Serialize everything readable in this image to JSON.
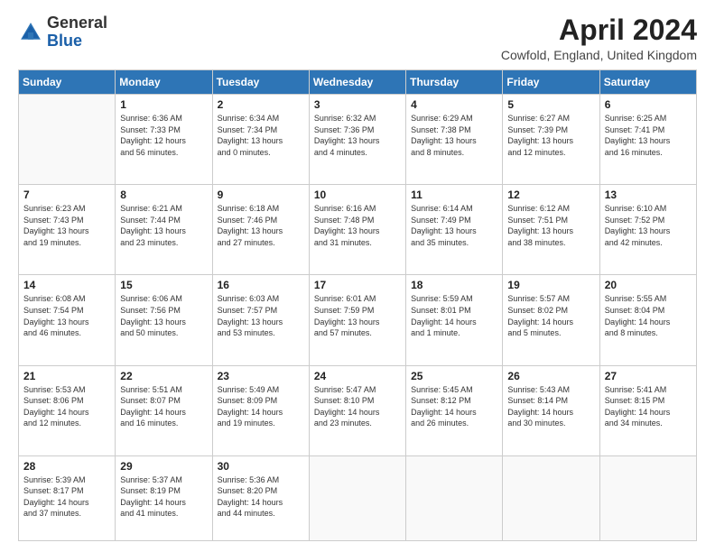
{
  "header": {
    "logo_general": "General",
    "logo_blue": "Blue",
    "month_title": "April 2024",
    "location": "Cowfold, England, United Kingdom"
  },
  "days_of_week": [
    "Sunday",
    "Monday",
    "Tuesday",
    "Wednesday",
    "Thursday",
    "Friday",
    "Saturday"
  ],
  "weeks": [
    [
      {
        "day": "",
        "info": ""
      },
      {
        "day": "1",
        "info": "Sunrise: 6:36 AM\nSunset: 7:33 PM\nDaylight: 12 hours\nand 56 minutes."
      },
      {
        "day": "2",
        "info": "Sunrise: 6:34 AM\nSunset: 7:34 PM\nDaylight: 13 hours\nand 0 minutes."
      },
      {
        "day": "3",
        "info": "Sunrise: 6:32 AM\nSunset: 7:36 PM\nDaylight: 13 hours\nand 4 minutes."
      },
      {
        "day": "4",
        "info": "Sunrise: 6:29 AM\nSunset: 7:38 PM\nDaylight: 13 hours\nand 8 minutes."
      },
      {
        "day": "5",
        "info": "Sunrise: 6:27 AM\nSunset: 7:39 PM\nDaylight: 13 hours\nand 12 minutes."
      },
      {
        "day": "6",
        "info": "Sunrise: 6:25 AM\nSunset: 7:41 PM\nDaylight: 13 hours\nand 16 minutes."
      }
    ],
    [
      {
        "day": "7",
        "info": "Sunrise: 6:23 AM\nSunset: 7:43 PM\nDaylight: 13 hours\nand 19 minutes."
      },
      {
        "day": "8",
        "info": "Sunrise: 6:21 AM\nSunset: 7:44 PM\nDaylight: 13 hours\nand 23 minutes."
      },
      {
        "day": "9",
        "info": "Sunrise: 6:18 AM\nSunset: 7:46 PM\nDaylight: 13 hours\nand 27 minutes."
      },
      {
        "day": "10",
        "info": "Sunrise: 6:16 AM\nSunset: 7:48 PM\nDaylight: 13 hours\nand 31 minutes."
      },
      {
        "day": "11",
        "info": "Sunrise: 6:14 AM\nSunset: 7:49 PM\nDaylight: 13 hours\nand 35 minutes."
      },
      {
        "day": "12",
        "info": "Sunrise: 6:12 AM\nSunset: 7:51 PM\nDaylight: 13 hours\nand 38 minutes."
      },
      {
        "day": "13",
        "info": "Sunrise: 6:10 AM\nSunset: 7:52 PM\nDaylight: 13 hours\nand 42 minutes."
      }
    ],
    [
      {
        "day": "14",
        "info": "Sunrise: 6:08 AM\nSunset: 7:54 PM\nDaylight: 13 hours\nand 46 minutes."
      },
      {
        "day": "15",
        "info": "Sunrise: 6:06 AM\nSunset: 7:56 PM\nDaylight: 13 hours\nand 50 minutes."
      },
      {
        "day": "16",
        "info": "Sunrise: 6:03 AM\nSunset: 7:57 PM\nDaylight: 13 hours\nand 53 minutes."
      },
      {
        "day": "17",
        "info": "Sunrise: 6:01 AM\nSunset: 7:59 PM\nDaylight: 13 hours\nand 57 minutes."
      },
      {
        "day": "18",
        "info": "Sunrise: 5:59 AM\nSunset: 8:01 PM\nDaylight: 14 hours\nand 1 minute."
      },
      {
        "day": "19",
        "info": "Sunrise: 5:57 AM\nSunset: 8:02 PM\nDaylight: 14 hours\nand 5 minutes."
      },
      {
        "day": "20",
        "info": "Sunrise: 5:55 AM\nSunset: 8:04 PM\nDaylight: 14 hours\nand 8 minutes."
      }
    ],
    [
      {
        "day": "21",
        "info": "Sunrise: 5:53 AM\nSunset: 8:06 PM\nDaylight: 14 hours\nand 12 minutes."
      },
      {
        "day": "22",
        "info": "Sunrise: 5:51 AM\nSunset: 8:07 PM\nDaylight: 14 hours\nand 16 minutes."
      },
      {
        "day": "23",
        "info": "Sunrise: 5:49 AM\nSunset: 8:09 PM\nDaylight: 14 hours\nand 19 minutes."
      },
      {
        "day": "24",
        "info": "Sunrise: 5:47 AM\nSunset: 8:10 PM\nDaylight: 14 hours\nand 23 minutes."
      },
      {
        "day": "25",
        "info": "Sunrise: 5:45 AM\nSunset: 8:12 PM\nDaylight: 14 hours\nand 26 minutes."
      },
      {
        "day": "26",
        "info": "Sunrise: 5:43 AM\nSunset: 8:14 PM\nDaylight: 14 hours\nand 30 minutes."
      },
      {
        "day": "27",
        "info": "Sunrise: 5:41 AM\nSunset: 8:15 PM\nDaylight: 14 hours\nand 34 minutes."
      }
    ],
    [
      {
        "day": "28",
        "info": "Sunrise: 5:39 AM\nSunset: 8:17 PM\nDaylight: 14 hours\nand 37 minutes."
      },
      {
        "day": "29",
        "info": "Sunrise: 5:37 AM\nSunset: 8:19 PM\nDaylight: 14 hours\nand 41 minutes."
      },
      {
        "day": "30",
        "info": "Sunrise: 5:36 AM\nSunset: 8:20 PM\nDaylight: 14 hours\nand 44 minutes."
      },
      {
        "day": "",
        "info": ""
      },
      {
        "day": "",
        "info": ""
      },
      {
        "day": "",
        "info": ""
      },
      {
        "day": "",
        "info": ""
      }
    ]
  ]
}
